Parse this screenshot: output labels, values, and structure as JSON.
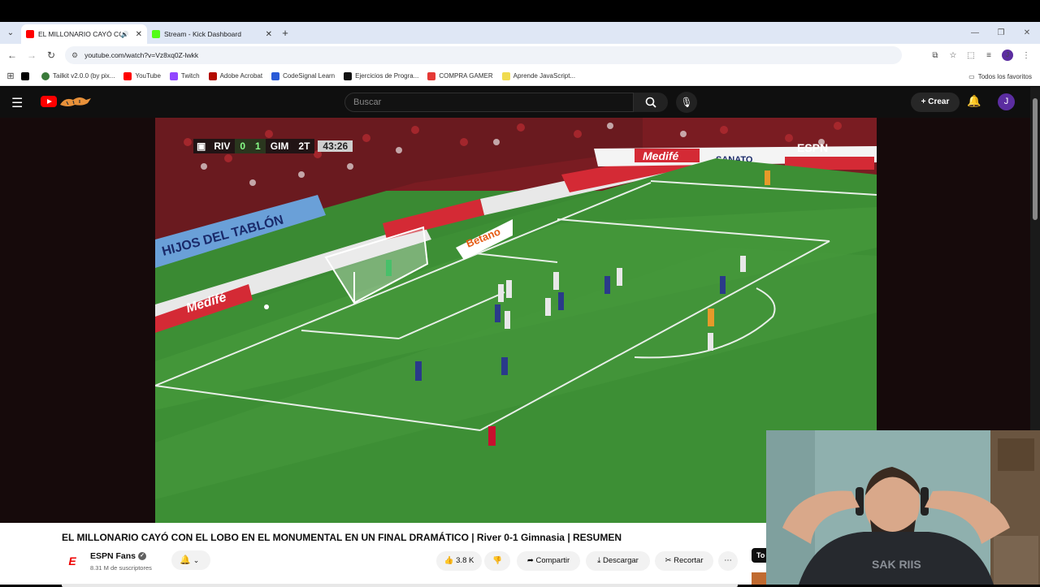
{
  "browser": {
    "tabs": [
      {
        "title": "EL MILLONARIO CAYÓ CON",
        "active": true,
        "audio": true
      },
      {
        "title": "Stream - Kick Dashboard",
        "active": false
      }
    ],
    "url": "youtube.com/watch?v=Vz8xq0Z-lwkk",
    "bookmarks": [
      {
        "label": "",
        "icon": "x-icon"
      },
      {
        "label": "Tailkit v2.0.0 (by pix...",
        "icon": "tailkit-icon"
      },
      {
        "label": "YouTube",
        "icon": "youtube-icon"
      },
      {
        "label": "Twitch",
        "icon": "twitch-icon"
      },
      {
        "label": "Adobe Acrobat",
        "icon": "acrobat-icon"
      },
      {
        "label": "CodeSignal Learn",
        "icon": "codesignal-icon"
      },
      {
        "label": "Ejercicios de Progra...",
        "icon": "exercise-icon"
      },
      {
        "label": "COMPRA GAMER",
        "icon": "compragamer-icon"
      },
      {
        "label": "Aprende JavaScript...",
        "icon": "js-icon"
      }
    ],
    "all_bookmarks": "Todos los favoritos",
    "profile_initial": "J"
  },
  "youtube": {
    "search_placeholder": "Buscar",
    "create_label": "Crear",
    "avatar_initial": "J",
    "video": {
      "title": "EL MILLONARIO CAYÓ CON EL LOBO EN EL MONUMENTAL EN UN FINAL DRAMÁTICO | River 0-1 Gimnasia | RESUMEN",
      "channel": "ESPN Fans",
      "subscribers": "8.31 M de suscriptores",
      "likes": "3.8 K",
      "share_label": "Compartir",
      "download_label": "Descargar",
      "clip_label": "Recortar",
      "side_tag": "To"
    },
    "scorebug": {
      "home": "RIV",
      "home_score": "0",
      "away_score": "1",
      "away": "GIM",
      "period": "2T",
      "clock": "43:26"
    },
    "ads": {
      "left_board": "Medifé",
      "center_board": "Betano",
      "right_board": "Medifé",
      "sanatorio": "SANATO",
      "espn": "ESPN",
      "tablon": "HIJOS DEL TABLÓN"
    }
  },
  "colors": {
    "yt_red": "#ff0000",
    "pitch_green": "#3a8a33",
    "river_red": "#c8102e",
    "gim_blue": "#2a3a8a"
  }
}
